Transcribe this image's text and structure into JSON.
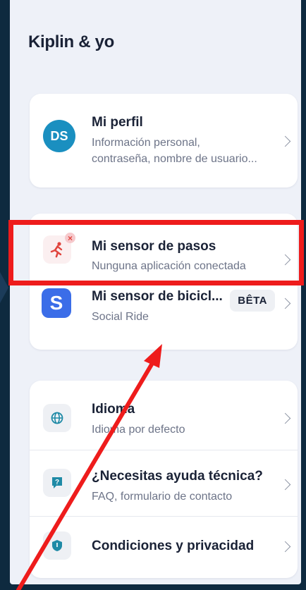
{
  "page": {
    "title": "Kiplin & yo"
  },
  "profile": {
    "avatar_initials": "DS",
    "avatar_color": "#1a8fc0",
    "title": "Mi perfil",
    "subtitle_line1": "Información personal,",
    "subtitle_line2": "contraseña, nombre de usuario..."
  },
  "sensors": {
    "steps": {
      "icon": "running-person-icon",
      "status_icon": "disconnected-x-icon",
      "title": "Mi sensor de pasos",
      "subtitle": "Nunguna aplicación conectada"
    },
    "bike": {
      "icon": "social-ride-s-icon",
      "icon_color": "#3b6de8",
      "icon_letter": "S",
      "title": "Mi sensor de bicicl...",
      "subtitle": "Social Ride",
      "badge": "BÊTA"
    }
  },
  "settings": {
    "language": {
      "icon": "globe-icon",
      "title": "Idioma",
      "subtitle": "Idioma por defecto"
    },
    "help": {
      "icon": "help-chat-icon",
      "title": "¿Necesitas ayuda técnica?",
      "subtitle": "FAQ, formulario de contacto"
    },
    "privacy": {
      "icon": "shield-icon",
      "title": "Condiciones y privacidad"
    }
  },
  "annotations": {
    "highlight_color": "#ee1c1c",
    "arrow_color": "#ee1c1c"
  }
}
